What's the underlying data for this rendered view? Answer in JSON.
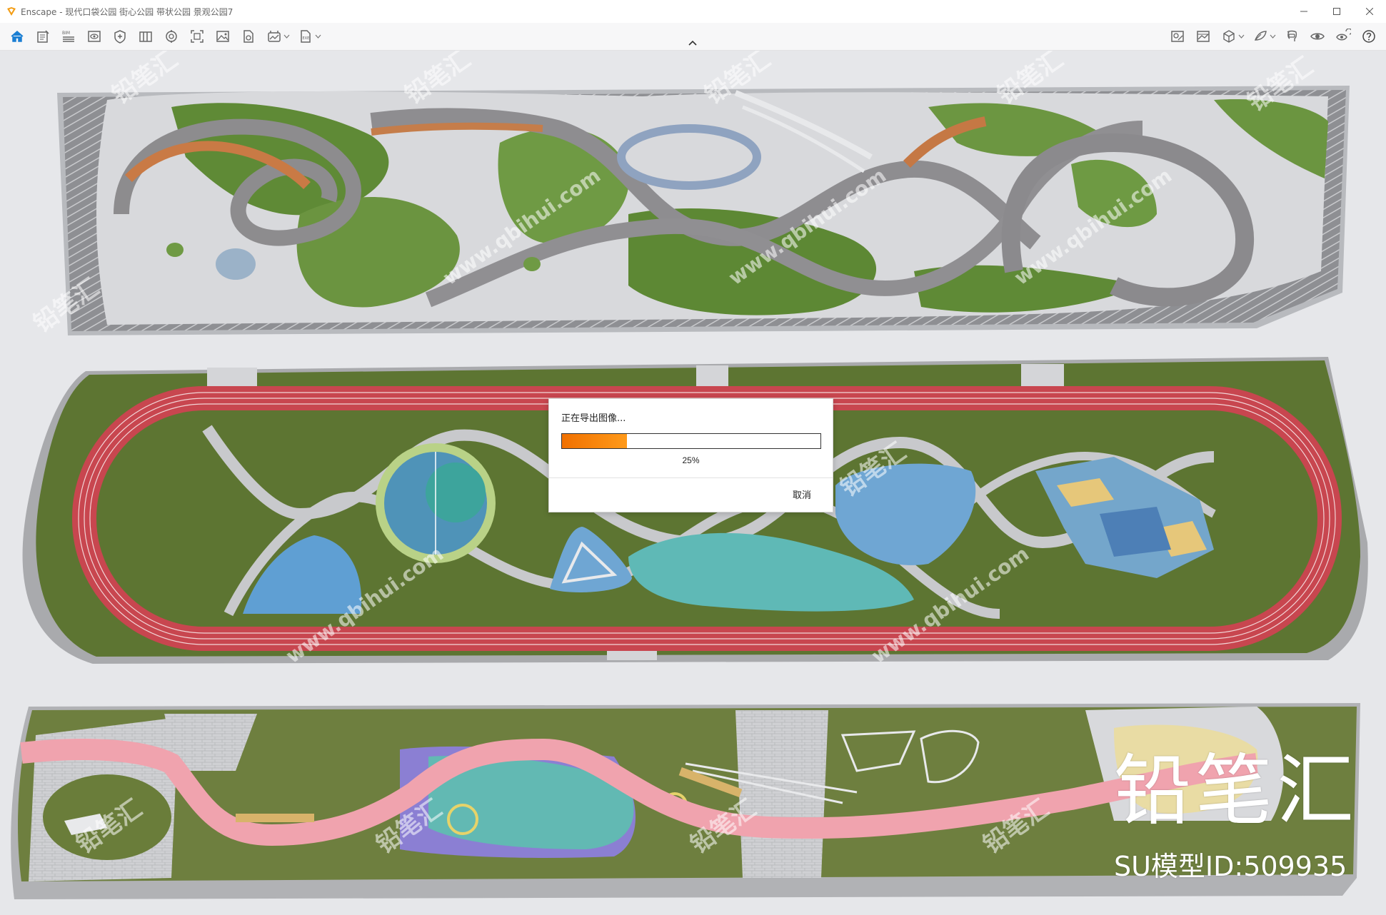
{
  "window": {
    "app_name": "Enscape",
    "title": "Enscape - 现代口袋公园 街心公园 带状公园 景观公园7",
    "controls": [
      "minimize",
      "maximize",
      "close"
    ]
  },
  "toolbar": {
    "left_icons": [
      "home-icon",
      "project-notes-icon",
      "bim-info-icon",
      "view-icon",
      "capture-icon",
      "views-panel-icon",
      "asset-library-icon",
      "batch-render-icon",
      "image-icon",
      "export-icon",
      "panorama-icon",
      "export-file-icon"
    ],
    "bim_label": "BIM",
    "exe_label": "EXE",
    "right_icons": [
      "material-editor-icon",
      "atmosphere-icon",
      "object-icon",
      "paint-icon",
      "vr-headset-icon",
      "live-update-icon",
      "sync-views-icon",
      "help-icon"
    ]
  },
  "dialog": {
    "title": "正在导出图像...",
    "progress": 0.25,
    "progress_text": "25%",
    "cancel_label": "取消"
  },
  "watermark": {
    "brand": "铅笔汇",
    "site": "www.qbihui.com",
    "model_id": "SU模型ID:509935"
  },
  "colors": {
    "titlebar": "#ffffff",
    "toolbar": "#f7f7f8",
    "accent": "#1b7fd3",
    "progress": "#f47a00",
    "grass": "#5e7a35",
    "track_red": "#c8464f",
    "plaza": "#d5d6d8",
    "water_blue": "#6fa6d3",
    "pink_path": "#f0a3ae",
    "teal": "#5fb9b6"
  }
}
